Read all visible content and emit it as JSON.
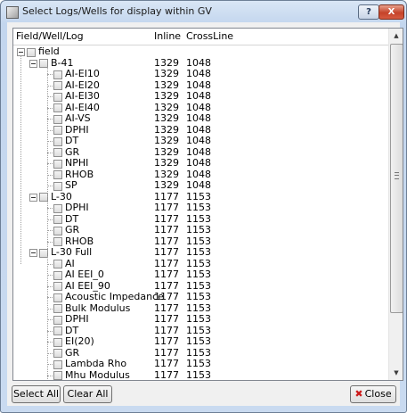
{
  "window": {
    "title": "Select Logs/Wells for display within GV"
  },
  "titlebar": {
    "help_label": "?",
    "close_label": "X"
  },
  "columns": {
    "name": "Field/Well/Log",
    "inline": "Inline",
    "crossline": "CrossLine"
  },
  "tree": {
    "rows": [
      {
        "level": 0,
        "type": "field",
        "label": "field",
        "inline": "",
        "crossline": ""
      },
      {
        "level": 1,
        "type": "well",
        "label": "B-41",
        "inline": "1329",
        "crossline": "1048"
      },
      {
        "level": 2,
        "type": "log",
        "label": "AI-EI10",
        "inline": "1329",
        "crossline": "1048"
      },
      {
        "level": 2,
        "type": "log",
        "label": "AI-EI20",
        "inline": "1329",
        "crossline": "1048"
      },
      {
        "level": 2,
        "type": "log",
        "label": "AI-EI30",
        "inline": "1329",
        "crossline": "1048"
      },
      {
        "level": 2,
        "type": "log",
        "label": "AI-EI40",
        "inline": "1329",
        "crossline": "1048"
      },
      {
        "level": 2,
        "type": "log",
        "label": "AI-VS",
        "inline": "1329",
        "crossline": "1048"
      },
      {
        "level": 2,
        "type": "log",
        "label": "DPHI",
        "inline": "1329",
        "crossline": "1048"
      },
      {
        "level": 2,
        "type": "log",
        "label": "DT",
        "inline": "1329",
        "crossline": "1048"
      },
      {
        "level": 2,
        "type": "log",
        "label": "GR",
        "inline": "1329",
        "crossline": "1048"
      },
      {
        "level": 2,
        "type": "log",
        "label": "NPHI",
        "inline": "1329",
        "crossline": "1048"
      },
      {
        "level": 2,
        "type": "log",
        "label": "RHOB",
        "inline": "1329",
        "crossline": "1048"
      },
      {
        "level": 2,
        "type": "log",
        "label": "SP",
        "inline": "1329",
        "crossline": "1048"
      },
      {
        "level": 1,
        "type": "well",
        "label": "L-30",
        "inline": "1177",
        "crossline": "1153"
      },
      {
        "level": 2,
        "type": "log",
        "label": "DPHI",
        "inline": "1177",
        "crossline": "1153"
      },
      {
        "level": 2,
        "type": "log",
        "label": "DT",
        "inline": "1177",
        "crossline": "1153"
      },
      {
        "level": 2,
        "type": "log",
        "label": "GR",
        "inline": "1177",
        "crossline": "1153"
      },
      {
        "level": 2,
        "type": "log",
        "label": "RHOB",
        "inline": "1177",
        "crossline": "1153"
      },
      {
        "level": 1,
        "type": "well",
        "label": "L-30 Full",
        "inline": "1177",
        "crossline": "1153"
      },
      {
        "level": 2,
        "type": "log",
        "label": "AI",
        "inline": "1177",
        "crossline": "1153"
      },
      {
        "level": 2,
        "type": "log",
        "label": "AI EEI_0",
        "inline": "1177",
        "crossline": "1153"
      },
      {
        "level": 2,
        "type": "log",
        "label": "AI EEI_90",
        "inline": "1177",
        "crossline": "1153"
      },
      {
        "level": 2,
        "type": "log",
        "label": "Acoustic Impedance",
        "inline": "1177",
        "crossline": "1153"
      },
      {
        "level": 2,
        "type": "log",
        "label": "Bulk Modulus",
        "inline": "1177",
        "crossline": "1153"
      },
      {
        "level": 2,
        "type": "log",
        "label": "DPHI",
        "inline": "1177",
        "crossline": "1153"
      },
      {
        "level": 2,
        "type": "log",
        "label": "DT",
        "inline": "1177",
        "crossline": "1153"
      },
      {
        "level": 2,
        "type": "log",
        "label": "EI(20)",
        "inline": "1177",
        "crossline": "1153"
      },
      {
        "level": 2,
        "type": "log",
        "label": "GR",
        "inline": "1177",
        "crossline": "1153"
      },
      {
        "level": 2,
        "type": "log",
        "label": "Lambda Rho",
        "inline": "1177",
        "crossline": "1153"
      },
      {
        "level": 2,
        "type": "log",
        "label": "Mhu Modulus",
        "inline": "1177",
        "crossline": "1153"
      }
    ]
  },
  "scrollbar": {
    "up_arrow": "▲",
    "down_arrow": "▼"
  },
  "buttons": {
    "select_all": "Select All",
    "clear_all": "Clear All",
    "close": "Close",
    "close_icon": "✖"
  }
}
